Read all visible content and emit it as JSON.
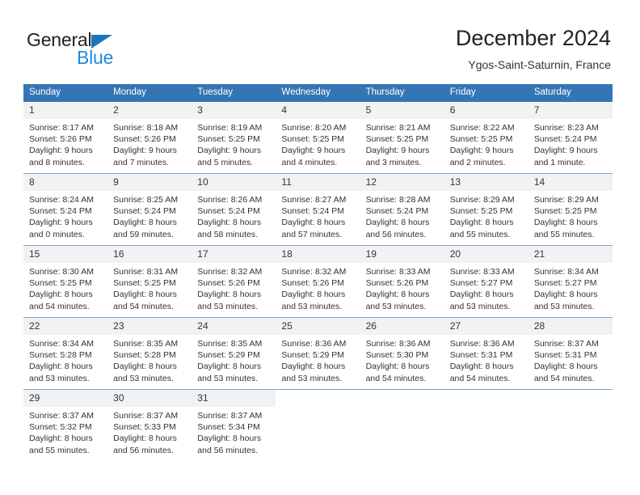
{
  "brand": {
    "name_part1": "General",
    "name_part2": "Blue",
    "triangle_color": "#1b75bb",
    "blue_color": "#1b8ae0"
  },
  "header": {
    "title": "December 2024",
    "subtitle": "Ygos-Saint-Saturnin, France"
  },
  "theme": {
    "header_row_bg": "#3475b4",
    "header_row_text": "#ffffff",
    "daynum_bg": "#f2f2f2",
    "grid_line": "#7ba2ce",
    "text": "#333333"
  },
  "weekday_headers": [
    "Sunday",
    "Monday",
    "Tuesday",
    "Wednesday",
    "Thursday",
    "Friday",
    "Saturday"
  ],
  "weeks": [
    [
      {
        "day": "1",
        "sunrise": "Sunrise: 8:17 AM",
        "sunset": "Sunset: 5:26 PM",
        "daylight1": "Daylight: 9 hours",
        "daylight2": "and 8 minutes."
      },
      {
        "day": "2",
        "sunrise": "Sunrise: 8:18 AM",
        "sunset": "Sunset: 5:26 PM",
        "daylight1": "Daylight: 9 hours",
        "daylight2": "and 7 minutes."
      },
      {
        "day": "3",
        "sunrise": "Sunrise: 8:19 AM",
        "sunset": "Sunset: 5:25 PM",
        "daylight1": "Daylight: 9 hours",
        "daylight2": "and 5 minutes."
      },
      {
        "day": "4",
        "sunrise": "Sunrise: 8:20 AM",
        "sunset": "Sunset: 5:25 PM",
        "daylight1": "Daylight: 9 hours",
        "daylight2": "and 4 minutes."
      },
      {
        "day": "5",
        "sunrise": "Sunrise: 8:21 AM",
        "sunset": "Sunset: 5:25 PM",
        "daylight1": "Daylight: 9 hours",
        "daylight2": "and 3 minutes."
      },
      {
        "day": "6",
        "sunrise": "Sunrise: 8:22 AM",
        "sunset": "Sunset: 5:25 PM",
        "daylight1": "Daylight: 9 hours",
        "daylight2": "and 2 minutes."
      },
      {
        "day": "7",
        "sunrise": "Sunrise: 8:23 AM",
        "sunset": "Sunset: 5:24 PM",
        "daylight1": "Daylight: 9 hours",
        "daylight2": "and 1 minute."
      }
    ],
    [
      {
        "day": "8",
        "sunrise": "Sunrise: 8:24 AM",
        "sunset": "Sunset: 5:24 PM",
        "daylight1": "Daylight: 9 hours",
        "daylight2": "and 0 minutes."
      },
      {
        "day": "9",
        "sunrise": "Sunrise: 8:25 AM",
        "sunset": "Sunset: 5:24 PM",
        "daylight1": "Daylight: 8 hours",
        "daylight2": "and 59 minutes."
      },
      {
        "day": "10",
        "sunrise": "Sunrise: 8:26 AM",
        "sunset": "Sunset: 5:24 PM",
        "daylight1": "Daylight: 8 hours",
        "daylight2": "and 58 minutes."
      },
      {
        "day": "11",
        "sunrise": "Sunrise: 8:27 AM",
        "sunset": "Sunset: 5:24 PM",
        "daylight1": "Daylight: 8 hours",
        "daylight2": "and 57 minutes."
      },
      {
        "day": "12",
        "sunrise": "Sunrise: 8:28 AM",
        "sunset": "Sunset: 5:24 PM",
        "daylight1": "Daylight: 8 hours",
        "daylight2": "and 56 minutes."
      },
      {
        "day": "13",
        "sunrise": "Sunrise: 8:29 AM",
        "sunset": "Sunset: 5:25 PM",
        "daylight1": "Daylight: 8 hours",
        "daylight2": "and 55 minutes."
      },
      {
        "day": "14",
        "sunrise": "Sunrise: 8:29 AM",
        "sunset": "Sunset: 5:25 PM",
        "daylight1": "Daylight: 8 hours",
        "daylight2": "and 55 minutes."
      }
    ],
    [
      {
        "day": "15",
        "sunrise": "Sunrise: 8:30 AM",
        "sunset": "Sunset: 5:25 PM",
        "daylight1": "Daylight: 8 hours",
        "daylight2": "and 54 minutes."
      },
      {
        "day": "16",
        "sunrise": "Sunrise: 8:31 AM",
        "sunset": "Sunset: 5:25 PM",
        "daylight1": "Daylight: 8 hours",
        "daylight2": "and 54 minutes."
      },
      {
        "day": "17",
        "sunrise": "Sunrise: 8:32 AM",
        "sunset": "Sunset: 5:26 PM",
        "daylight1": "Daylight: 8 hours",
        "daylight2": "and 53 minutes."
      },
      {
        "day": "18",
        "sunrise": "Sunrise: 8:32 AM",
        "sunset": "Sunset: 5:26 PM",
        "daylight1": "Daylight: 8 hours",
        "daylight2": "and 53 minutes."
      },
      {
        "day": "19",
        "sunrise": "Sunrise: 8:33 AM",
        "sunset": "Sunset: 5:26 PM",
        "daylight1": "Daylight: 8 hours",
        "daylight2": "and 53 minutes."
      },
      {
        "day": "20",
        "sunrise": "Sunrise: 8:33 AM",
        "sunset": "Sunset: 5:27 PM",
        "daylight1": "Daylight: 8 hours",
        "daylight2": "and 53 minutes."
      },
      {
        "day": "21",
        "sunrise": "Sunrise: 8:34 AM",
        "sunset": "Sunset: 5:27 PM",
        "daylight1": "Daylight: 8 hours",
        "daylight2": "and 53 minutes."
      }
    ],
    [
      {
        "day": "22",
        "sunrise": "Sunrise: 8:34 AM",
        "sunset": "Sunset: 5:28 PM",
        "daylight1": "Daylight: 8 hours",
        "daylight2": "and 53 minutes."
      },
      {
        "day": "23",
        "sunrise": "Sunrise: 8:35 AM",
        "sunset": "Sunset: 5:28 PM",
        "daylight1": "Daylight: 8 hours",
        "daylight2": "and 53 minutes."
      },
      {
        "day": "24",
        "sunrise": "Sunrise: 8:35 AM",
        "sunset": "Sunset: 5:29 PM",
        "daylight1": "Daylight: 8 hours",
        "daylight2": "and 53 minutes."
      },
      {
        "day": "25",
        "sunrise": "Sunrise: 8:36 AM",
        "sunset": "Sunset: 5:29 PM",
        "daylight1": "Daylight: 8 hours",
        "daylight2": "and 53 minutes."
      },
      {
        "day": "26",
        "sunrise": "Sunrise: 8:36 AM",
        "sunset": "Sunset: 5:30 PM",
        "daylight1": "Daylight: 8 hours",
        "daylight2": "and 54 minutes."
      },
      {
        "day": "27",
        "sunrise": "Sunrise: 8:36 AM",
        "sunset": "Sunset: 5:31 PM",
        "daylight1": "Daylight: 8 hours",
        "daylight2": "and 54 minutes."
      },
      {
        "day": "28",
        "sunrise": "Sunrise: 8:37 AM",
        "sunset": "Sunset: 5:31 PM",
        "daylight1": "Daylight: 8 hours",
        "daylight2": "and 54 minutes."
      }
    ],
    [
      {
        "day": "29",
        "sunrise": "Sunrise: 8:37 AM",
        "sunset": "Sunset: 5:32 PM",
        "daylight1": "Daylight: 8 hours",
        "daylight2": "and 55 minutes."
      },
      {
        "day": "30",
        "sunrise": "Sunrise: 8:37 AM",
        "sunset": "Sunset: 5:33 PM",
        "daylight1": "Daylight: 8 hours",
        "daylight2": "and 56 minutes."
      },
      {
        "day": "31",
        "sunrise": "Sunrise: 8:37 AM",
        "sunset": "Sunset: 5:34 PM",
        "daylight1": "Daylight: 8 hours",
        "daylight2": "and 56 minutes."
      },
      {
        "day": "",
        "sunrise": "",
        "sunset": "",
        "daylight1": "",
        "daylight2": ""
      },
      {
        "day": "",
        "sunrise": "",
        "sunset": "",
        "daylight1": "",
        "daylight2": ""
      },
      {
        "day": "",
        "sunrise": "",
        "sunset": "",
        "daylight1": "",
        "daylight2": ""
      },
      {
        "day": "",
        "sunrise": "",
        "sunset": "",
        "daylight1": "",
        "daylight2": ""
      }
    ]
  ]
}
